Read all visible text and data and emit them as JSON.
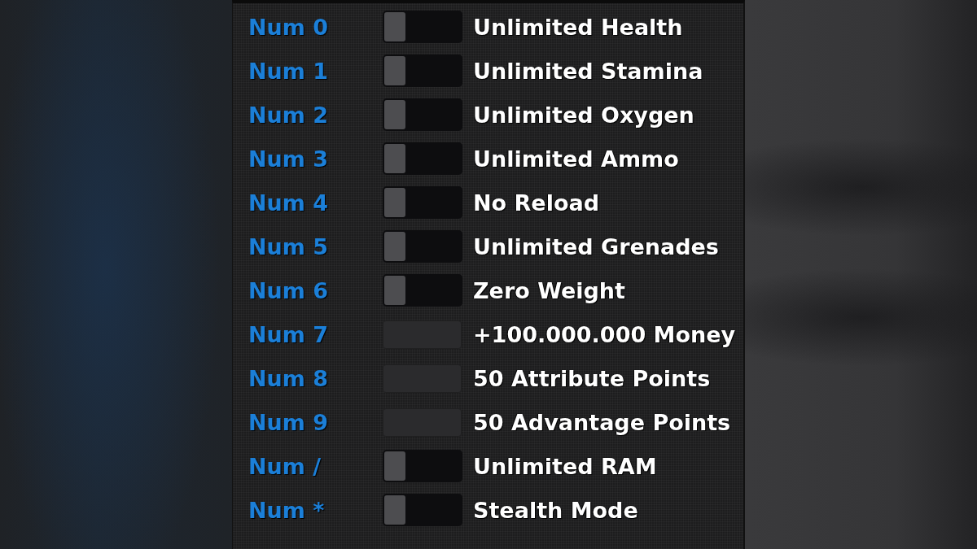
{
  "cheats": [
    {
      "hotkey": "Num 0",
      "kind": "toggle",
      "on": false,
      "label": "Unlimited Health"
    },
    {
      "hotkey": "Num 1",
      "kind": "toggle",
      "on": false,
      "label": "Unlimited Stamina"
    },
    {
      "hotkey": "Num 2",
      "kind": "toggle",
      "on": false,
      "label": "Unlimited Oxygen"
    },
    {
      "hotkey": "Num 3",
      "kind": "toggle",
      "on": false,
      "label": "Unlimited Ammo"
    },
    {
      "hotkey": "Num 4",
      "kind": "toggle",
      "on": false,
      "label": "No Reload"
    },
    {
      "hotkey": "Num 5",
      "kind": "toggle",
      "on": false,
      "label": "Unlimited Grenades"
    },
    {
      "hotkey": "Num 6",
      "kind": "toggle",
      "on": false,
      "label": "Zero Weight"
    },
    {
      "hotkey": "Num 7",
      "kind": "button",
      "label": "+100.000.000 Money"
    },
    {
      "hotkey": "Num 8",
      "kind": "button",
      "label": "50 Attribute Points"
    },
    {
      "hotkey": "Num 9",
      "kind": "button",
      "label": "50 Advantage Points"
    },
    {
      "hotkey": "Num /",
      "kind": "toggle",
      "on": false,
      "label": "Unlimited RAM"
    },
    {
      "hotkey": "Num *",
      "kind": "toggle",
      "on": false,
      "label": "Stealth Mode"
    }
  ]
}
